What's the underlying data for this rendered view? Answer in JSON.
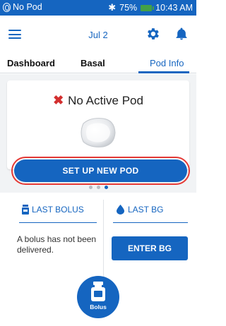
{
  "status_bar": {
    "pod_status": "No Pod",
    "battery_percent": "75%",
    "time": "10:43 AM"
  },
  "app_bar": {
    "date": "Jul 2"
  },
  "tabs": [
    {
      "label": "Dashboard"
    },
    {
      "label": "Basal"
    },
    {
      "label": "Pod Info"
    }
  ],
  "active_tab": "Pod Info",
  "pod_card": {
    "status": "No Active Pod",
    "setup_button": "SET UP NEW POD"
  },
  "pager": {
    "count": 3,
    "active_index": 2
  },
  "last_bolus": {
    "header": "LAST BOLUS",
    "message": "A bolus has not been delivered."
  },
  "last_bg": {
    "header": "LAST BG",
    "button": "ENTER BG"
  },
  "bolus_button": {
    "label": "Bolus"
  },
  "colors": {
    "primary": "#1565c0",
    "alert_red": "#d32f2f",
    "battery_green": "#43a047",
    "background": "#f1f3f5"
  }
}
